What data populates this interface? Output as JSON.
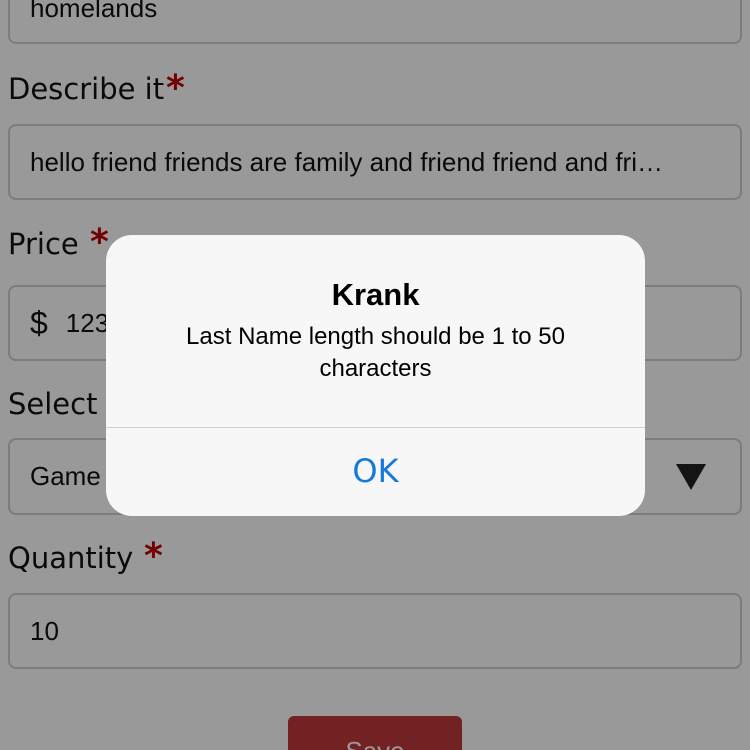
{
  "form": {
    "name_value": "homelands",
    "describe": {
      "label": "Describe it",
      "required_mark": "*",
      "value": "hello friend friends are family and friend friend and fri…"
    },
    "price": {
      "label": "Price",
      "required_mark": "*",
      "currency": "$",
      "value": "123"
    },
    "category": {
      "label": "Select C",
      "value": "Game"
    },
    "quantity": {
      "label": "Quantity",
      "required_mark": "*",
      "value": "10"
    },
    "save_label": "Save"
  },
  "alert": {
    "title": "Krank",
    "message": "Last Name length should be 1 to 50 characters",
    "ok_label": "OK"
  },
  "colors": {
    "accent_required": "#c00000",
    "ok_blue": "#1478e0",
    "save_red": "#c0393b"
  }
}
